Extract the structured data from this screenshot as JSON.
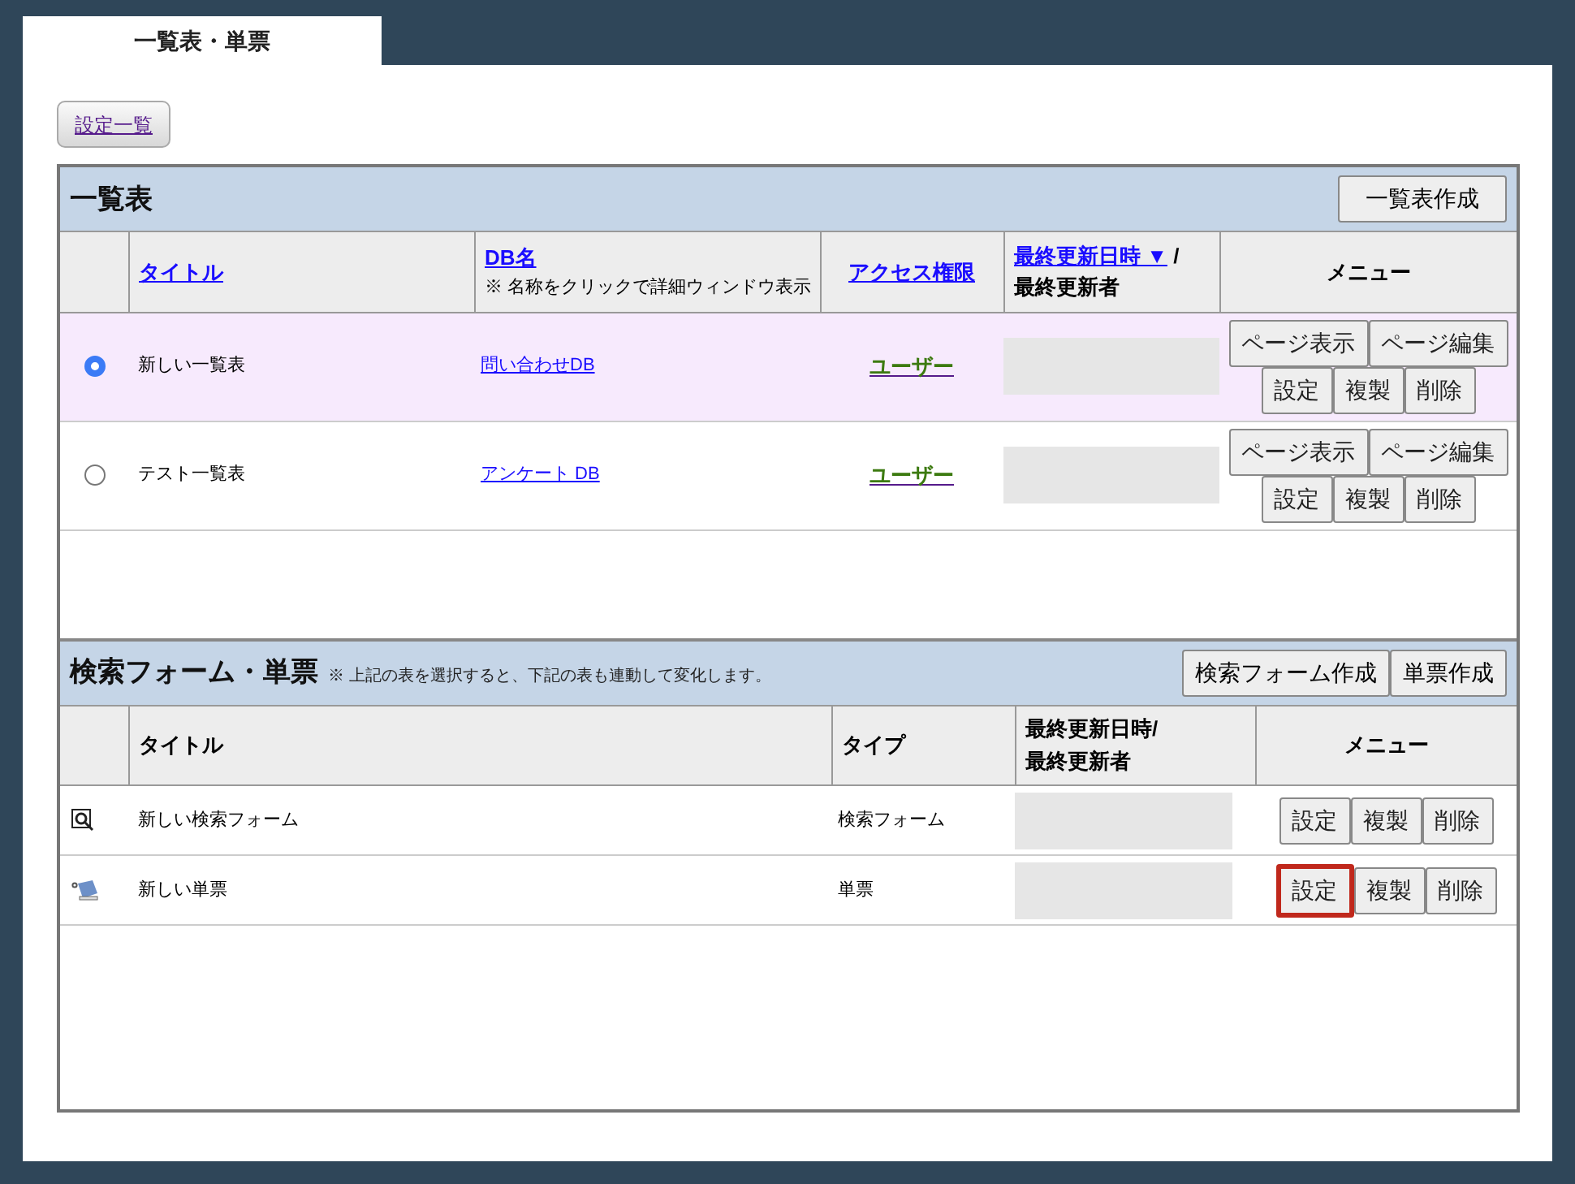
{
  "tabs": [
    {
      "label": "一覧表・単票",
      "selected": true
    }
  ],
  "settings_button": "設定一覧",
  "list_section": {
    "title": "一覧表",
    "create_button": "一覧表作成",
    "columns": [
      {
        "label": "タイトル",
        "kind": "link"
      },
      {
        "label": "DB名",
        "note": "※ 名称をクリックで詳細ウィンドウ表示",
        "kind": "link"
      },
      {
        "label": "アクセス権限",
        "kind": "link"
      },
      {
        "label": "最終更新日時 ▼",
        "suffix": "/",
        "line2": "最終更新者",
        "kind": "link"
      },
      {
        "label": "メニュー",
        "kind": "text"
      }
    ],
    "rows": [
      {
        "selected": true,
        "title": "新しい一覧表",
        "db": "問い合わせDB",
        "access": "ユーザー",
        "menu": [
          [
            "ページ表示",
            "ページ編集"
          ],
          [
            "設定",
            "複製",
            "削除"
          ]
        ]
      },
      {
        "selected": false,
        "title": "テスト一覧表",
        "db": "アンケート DB",
        "access": "ユーザー",
        "menu": [
          [
            "ページ表示",
            "ページ編集"
          ],
          [
            "設定",
            "複製",
            "削除"
          ]
        ]
      }
    ]
  },
  "form_section": {
    "title": "検索フォーム・単票",
    "note": "※ 上記の表を選択すると、下記の表も連動して変化します。",
    "create_buttons": [
      "検索フォーム作成",
      "単票作成"
    ],
    "columns": [
      "タイトル",
      "タイプ",
      "最終更新日時/\n最終更新者",
      "メニュー"
    ],
    "rows": [
      {
        "kind": "search",
        "title": "新しい検索フォーム",
        "type": "検索フォーム",
        "menu": [
          {
            "label": "設定",
            "highlighted": false
          },
          {
            "label": "複製",
            "highlighted": false
          },
          {
            "label": "削除",
            "highlighted": false
          }
        ]
      },
      {
        "kind": "sheet",
        "title": "新しい単票",
        "type": "単票",
        "menu": [
          {
            "label": "設定",
            "highlighted": true
          },
          {
            "label": "複製",
            "highlighted": false
          },
          {
            "label": "削除",
            "highlighted": false
          }
        ]
      }
    ]
  }
}
